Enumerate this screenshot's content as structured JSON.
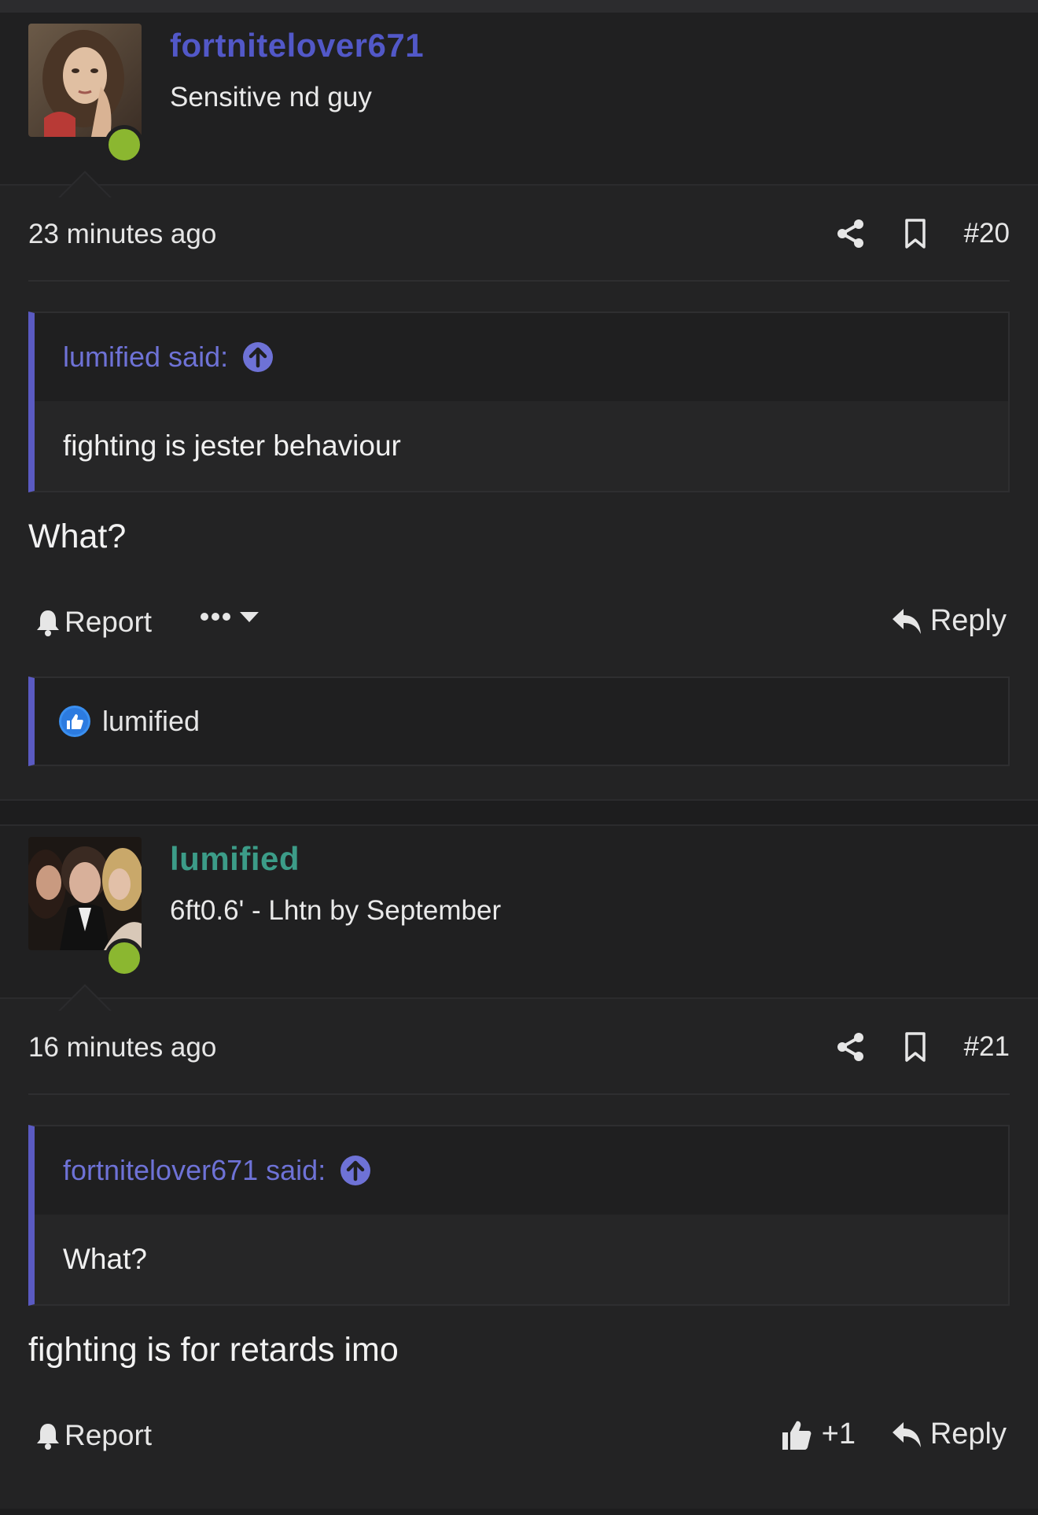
{
  "posts": [
    {
      "username": "fortnitelover671",
      "username_color": "#5258c8",
      "user_title": "Sensitive nd guy",
      "time": "23 minutes ago",
      "post_number": "#20",
      "quote": {
        "author": "lumified said:",
        "text": "fighting is jester behaviour"
      },
      "message": "What?",
      "report_label": "Report",
      "reply_label": "Reply",
      "liked_by": "lumified"
    },
    {
      "username": "lumified",
      "username_color": "#3c9c88",
      "user_title": "6ft0.6' - Lhtn by September",
      "time": "16 minutes ago",
      "post_number": "#21",
      "quote": {
        "author": "fortnitelover671 said:",
        "text": "What?"
      },
      "message": "fighting is for retards imo",
      "report_label": "Report",
      "like_count": "+1",
      "reply_label": "Reply"
    }
  ],
  "colors": {
    "accent": "#5a5ac2",
    "online": "#8bb730",
    "background": "#232324"
  },
  "icons": [
    "share-icon",
    "bookmark-icon",
    "arrow-up-circle-icon",
    "bell-icon",
    "more-dots-icon",
    "caret-down-icon",
    "reply-icon",
    "thumbs-up-icon",
    "like-badge-icon"
  ]
}
